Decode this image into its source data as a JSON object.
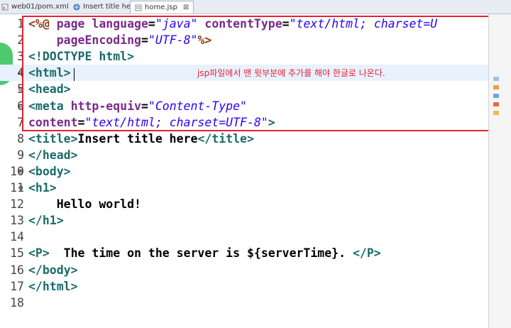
{
  "tabs": [
    {
      "label": "web01/pom.xml",
      "icon": "xml-file-icon",
      "active": false
    },
    {
      "label": "Insert title here",
      "icon": "browser-globe-icon",
      "active": false
    },
    {
      "label": "home.jsp",
      "icon": "jsp-file-icon",
      "active": true,
      "close": "⊠"
    }
  ],
  "colors": {
    "tag": "#1a6b6b",
    "directive": "#8a3b1a",
    "attribute": "#7a2a8a",
    "string": "#2a00ff",
    "highlight_box": "#e8212e"
  },
  "annotation": "jsp파일에서 맨 윗부분에 추가를 해야 한글로 나온다.",
  "code_lines": [
    {
      "n": "1",
      "fold": "",
      "t": [
        [
          "jt",
          "<%@ "
        ],
        [
          "at",
          "page "
        ],
        [
          "at",
          "language"
        ],
        [
          "tx",
          "="
        ],
        [
          "sv",
          "\"java\""
        ],
        [
          "tx",
          " "
        ],
        [
          "at",
          "contentType"
        ],
        [
          "tx",
          "="
        ],
        [
          "sv",
          "\"text/html; charset=U"
        ]
      ]
    },
    {
      "n": "2",
      "fold": "",
      "t": [
        [
          "tx",
          "    "
        ],
        [
          "at",
          "pageEncoding"
        ],
        [
          "tx",
          "="
        ],
        [
          "sv",
          "\"UTF-8\""
        ],
        [
          "jt",
          "%>"
        ]
      ]
    },
    {
      "n": "3",
      "fold": "",
      "t": [
        [
          "tg",
          "<!DOCTYPE html>"
        ]
      ]
    },
    {
      "n": "4",
      "fold": "⊖",
      "cur": true,
      "t": [
        [
          "tg",
          "<html>"
        ]
      ]
    },
    {
      "n": "5",
      "fold": "⊖",
      "t": [
        [
          "tg",
          "<head>"
        ]
      ]
    },
    {
      "n": "6",
      "fold": "⊖",
      "t": [
        [
          "tg",
          "<meta "
        ],
        [
          "at",
          "http-equiv"
        ],
        [
          "tx",
          "="
        ],
        [
          "sv",
          "\"Content-Type\""
        ]
      ]
    },
    {
      "n": "7",
      "fold": "",
      "t": [
        [
          "at",
          "content"
        ],
        [
          "tx",
          "="
        ],
        [
          "sv",
          "\"text/html; charset=UTF-8\""
        ],
        [
          "tg",
          ">"
        ]
      ]
    },
    {
      "n": "8",
      "fold": "",
      "t": [
        [
          "tg",
          "<title>"
        ],
        [
          "tx",
          "Insert title here"
        ],
        [
          "tg",
          "</title>"
        ]
      ]
    },
    {
      "n": "9",
      "fold": "",
      "t": [
        [
          "tg",
          "</head>"
        ]
      ]
    },
    {
      "n": "10",
      "fold": "⊖",
      "t": [
        [
          "tg",
          "<body>"
        ]
      ]
    },
    {
      "n": "11",
      "fold": "⊖",
      "t": [
        [
          "tg",
          "<h1>"
        ]
      ]
    },
    {
      "n": "12",
      "fold": "",
      "t": [
        [
          "tx",
          "    Hello world!"
        ]
      ]
    },
    {
      "n": "13",
      "fold": "",
      "t": [
        [
          "tg",
          "</h1>"
        ]
      ]
    },
    {
      "n": "14",
      "fold": "",
      "t": []
    },
    {
      "n": "15",
      "fold": "",
      "t": [
        [
          "tg",
          "<P>"
        ],
        [
          "tx",
          "  The time on the server is ${serverTime}. "
        ],
        [
          "tg",
          "</P>"
        ]
      ]
    },
    {
      "n": "16",
      "fold": "",
      "t": [
        [
          "tg",
          "</body>"
        ]
      ]
    },
    {
      "n": "17",
      "fold": "",
      "t": [
        [
          "tg",
          "</html>"
        ]
      ]
    },
    {
      "n": "18",
      "fold": "",
      "t": []
    }
  ]
}
